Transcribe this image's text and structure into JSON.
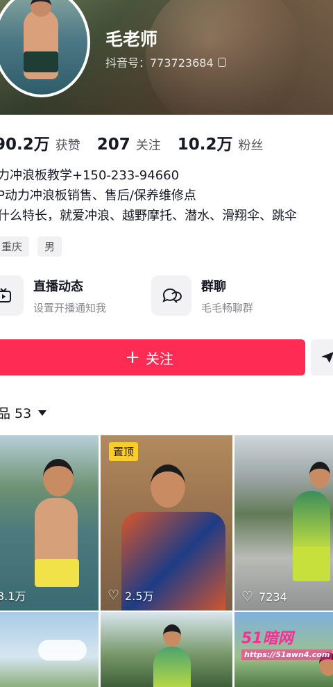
{
  "profile": {
    "name": "毛老师",
    "id_line": "抖音号：773723684"
  },
  "stats": [
    {
      "num": "90.2万",
      "label": "获赞"
    },
    {
      "num": "207",
      "label": "关注"
    },
    {
      "num": "10.2万",
      "label": "粉丝"
    }
  ],
  "bio": [
    "力冲浪板教学+150-233-94660",
    "P动力冲浪板销售、售后/保养维修点",
    "什么特长，就爱冲浪、越野摩托、潜水、滑翔伞、跳伞"
  ],
  "tags": [
    "重庆",
    "男"
  ],
  "actions": {
    "live": {
      "title": "直播动态",
      "subtitle": "设置开播通知我",
      "icon": "tv-icon"
    },
    "group": {
      "title": "群聊",
      "subtitle": "毛毛畅聊群",
      "icon": "chat-bubbles-icon"
    }
  },
  "follow": {
    "plus": "+",
    "label": "关注"
  },
  "works": {
    "label": "品 53"
  },
  "videos": [
    {
      "pinned_label": "",
      "likes": "3.1万"
    },
    {
      "pinned_label": "置顶",
      "likes": "2.5万"
    },
    {
      "pinned_label": "",
      "likes": "7234"
    },
    {
      "pinned_label": "",
      "likes": ""
    },
    {
      "pinned_label": "",
      "likes": ""
    },
    {
      "pinned_label": "",
      "likes": ""
    }
  ],
  "watermark": {
    "logo": "51暗网",
    "url": "https://51awn4.com"
  },
  "colors": {
    "accent": "#fe2c55",
    "pin_badge": "#facd2b",
    "watermark": "#ff2d95"
  }
}
